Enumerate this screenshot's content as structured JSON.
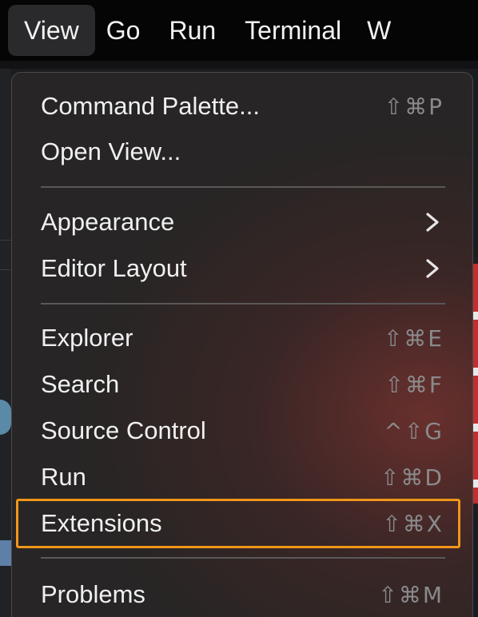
{
  "menubar": {
    "items": [
      {
        "label": "View",
        "active": true
      },
      {
        "label": "Go"
      },
      {
        "label": "Run"
      },
      {
        "label": "Terminal"
      },
      {
        "label": "W"
      }
    ]
  },
  "menu": {
    "groups": [
      [
        {
          "label": "Command Palette...",
          "shortcut": "⇧⌘P"
        },
        {
          "label": "Open View...",
          "shortcut": ""
        }
      ],
      [
        {
          "label": "Appearance",
          "submenu": true
        },
        {
          "label": "Editor Layout",
          "submenu": true
        }
      ],
      [
        {
          "label": "Explorer",
          "shortcut": "⇧⌘E"
        },
        {
          "label": "Search",
          "shortcut": "⇧⌘F"
        },
        {
          "label": "Source Control",
          "shortcut": "^⇧G"
        },
        {
          "label": "Run",
          "shortcut": "⇧⌘D"
        },
        {
          "label": "Extensions",
          "shortcut": "⇧⌘X",
          "highlighted": true
        }
      ],
      [
        {
          "label": "Problems",
          "shortcut": "⇧⌘M"
        }
      ]
    ]
  },
  "colors": {
    "highlight_border": "#f0961a",
    "menu_text": "#f0f0f0",
    "shortcut_text": "#8a8a8c"
  },
  "icons": {
    "submenu": "chevron-right-icon"
  }
}
